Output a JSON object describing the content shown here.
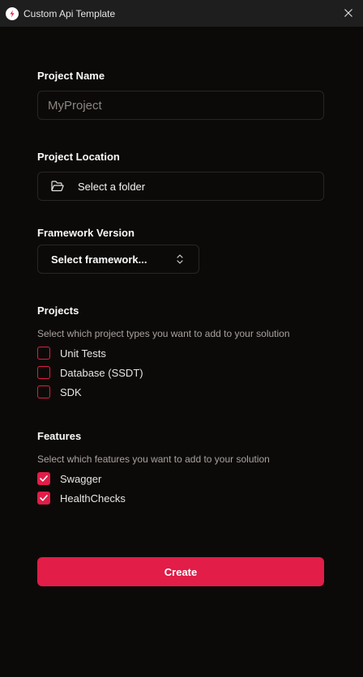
{
  "window": {
    "title": "Custom Api Template"
  },
  "project_name": {
    "label": "Project Name",
    "placeholder": "MyProject"
  },
  "project_location": {
    "label": "Project Location",
    "button_label": "Select a folder"
  },
  "framework": {
    "label": "Framework Version",
    "select_label": "Select framework..."
  },
  "projects": {
    "heading": "Projects",
    "description": "Select which project types you want to add to your solution",
    "items": [
      {
        "label": "Unit Tests",
        "checked": false
      },
      {
        "label": "Database (SSDT)",
        "checked": false
      },
      {
        "label": "SDK",
        "checked": false
      }
    ]
  },
  "features": {
    "heading": "Features",
    "description": "Select which features you want to add to your solution",
    "items": [
      {
        "label": "Swagger",
        "checked": true
      },
      {
        "label": "HealthChecks",
        "checked": true
      }
    ]
  },
  "create_label": "Create",
  "colors": {
    "accent": "#e11d48",
    "background": "#0c0a09",
    "titlebar": "#1e1e1e",
    "border": "#292524"
  }
}
